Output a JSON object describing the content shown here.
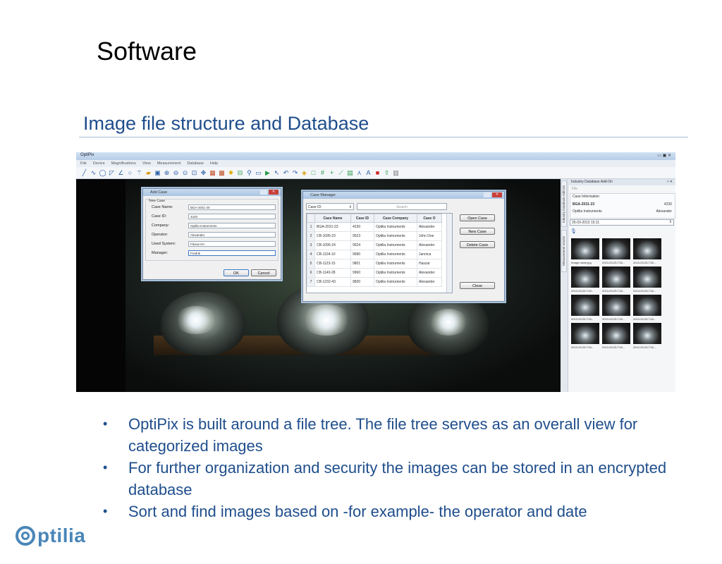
{
  "slide": {
    "title": "Software",
    "subtitle": "Image file structure and Database",
    "bullets": [
      "OptiPix is built around a file tree. The file tree serves as an overall view for categorized images",
      "For further organization and security the images can be stored in an encrypted database",
      "Sort and find images based on -for example- the operator and date"
    ],
    "bullet_char": "•",
    "logo_text": "ptilia"
  },
  "app": {
    "window_title": "OptiPix",
    "window_controls": "▭ ▣ ✕",
    "menu": [
      "File",
      "Device",
      "Magnifications",
      "View",
      "Measurement",
      "Database",
      "Help"
    ],
    "toolbar_icons": [
      "pen-icon",
      "curve-icon",
      "ellipse-icon",
      "shape-icon",
      "angle-icon",
      "circle-icon",
      "wand-icon",
      "open-icon",
      "save-icon",
      "zoom-in-icon",
      "zoom-out-icon",
      "zoom-fit-icon",
      "zoom-select-icon",
      "move-icon",
      "grid-icon",
      "calibrate-icon",
      "light-icon",
      "record-icon",
      "link-icon",
      "snapshot-icon",
      "play-icon",
      "pointer-icon",
      "undo-icon",
      "redo-icon",
      "eraser-icon",
      "rect-icon",
      "hash-icon",
      "cross-icon",
      "ruler-icon",
      "text-icon",
      "arrow-up-icon",
      "font-icon",
      "color-icon",
      "export-icon",
      "barcode-icon"
    ]
  },
  "add_case": {
    "title": "Add Case",
    "close": "✕",
    "group_label": "New Case",
    "fields": [
      {
        "label": "Case Name:",
        "value": "BGA-2041-40"
      },
      {
        "label": "Case ID:",
        "value": "4240"
      },
      {
        "label": "Company:",
        "value": "Optilia Instruments"
      },
      {
        "label": "Operator:",
        "value": "Alexander"
      },
      {
        "label": "Used System:",
        "value": "Flexia HH"
      },
      {
        "label": "Manager:",
        "value": "Fredrik"
      }
    ],
    "ok": "OK",
    "cancel": "Cancel"
  },
  "case_manager": {
    "title": "Case Manager",
    "close": "✕",
    "filter_select": "Case ID:",
    "search_placeholder": "Search",
    "columns": [
      "",
      "Case Name",
      "Case ID",
      "Case Company",
      "Case O"
    ],
    "rows": [
      [
        "1",
        "BGA-2031-23",
        "4230",
        "Optilia Instruments",
        "Alexander"
      ],
      [
        "2",
        "CB-1095-23",
        "9523",
        "Optilia Instruments",
        "John Doe"
      ],
      [
        "3",
        "CB-1095-24",
        "9524",
        "Optilia Instruments",
        "Alexander"
      ],
      [
        "4",
        "CB-1104-10",
        "9680",
        "Optilia Instruments",
        "Jannica"
      ],
      [
        "5",
        "CB-1123-15",
        "9801",
        "Optilia Instruments",
        "Haszar"
      ],
      [
        "6",
        "CB-1140-28",
        "9960",
        "Optilia Instruments",
        "Alexander"
      ],
      [
        "7",
        "CB-1232-43",
        "9830",
        "Optilia Instruments",
        "Alexander"
      ]
    ],
    "buttons": {
      "open": "Open Case",
      "new": "New Case",
      "delete": "Delete Case",
      "close_btn": "Close"
    }
  },
  "panel": {
    "header": "Industry Database Add-On",
    "pin": "ᵖ ✕",
    "tabs": [
      "Industry Database Add-On",
      "Measurement results"
    ],
    "file_label": "File",
    "case_info_label": "Case Information",
    "case_name": "BGA-2031-23",
    "case_id": "4230",
    "company": "Optilia Instruments",
    "operator": "Alexander",
    "date": "25-03-2013 15:11",
    "thumb_labels": [
      "Image name.jpg",
      "2013-03-25-T18...",
      "2013-03-25-T18...",
      "2013-03-25-T18...",
      "2013-03-25-T18...",
      "2013-03-25-T18...",
      "2013-03-25-T18...",
      "2013-03-25-T18...",
      "2013-03-25-T18...",
      "2013-03-25-T18...",
      "2013-03-25-T18...",
      "2013-03-25-T18..."
    ]
  }
}
